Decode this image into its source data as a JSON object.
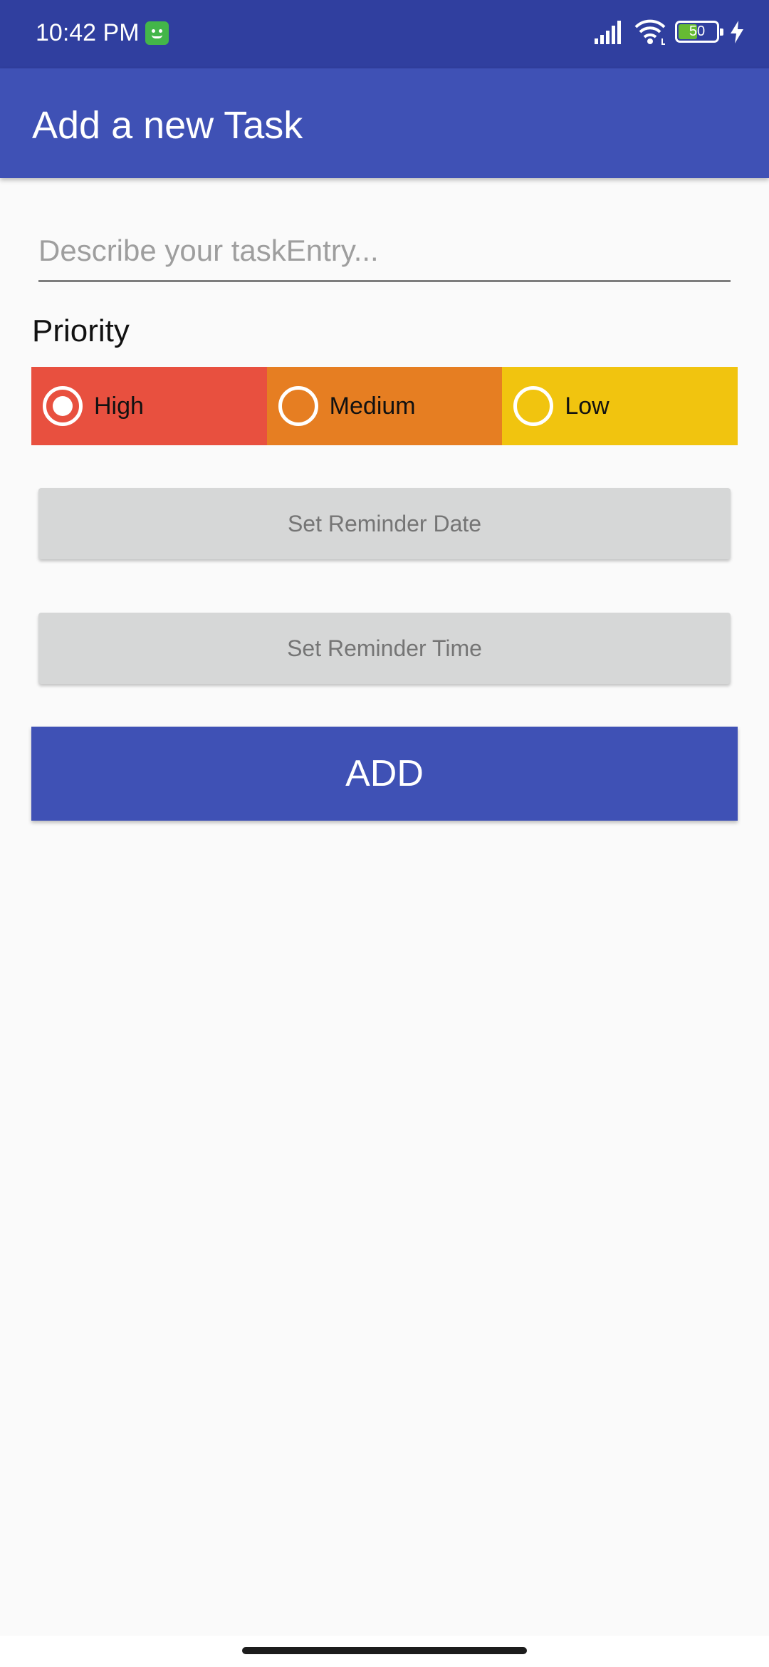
{
  "status_bar": {
    "time": "10:42 PM",
    "battery_level": "50",
    "icons": [
      "notification-app-icon",
      "signal-icon",
      "wifi-icon",
      "battery-icon",
      "charging-icon"
    ]
  },
  "app_bar": {
    "title": "Add a new Task"
  },
  "task_input": {
    "value": "",
    "placeholder": "Describe your taskEntry..."
  },
  "priority": {
    "label": "Priority",
    "options": [
      {
        "label": "High",
        "color": "#e8503f",
        "selected": true
      },
      {
        "label": "Medium",
        "color": "#e67e22",
        "selected": false
      },
      {
        "label": "Low",
        "color": "#f1c40f",
        "selected": false
      }
    ]
  },
  "buttons": {
    "set_date": "Set Reminder Date",
    "set_time": "Set Reminder Time",
    "add": "ADD"
  },
  "colors": {
    "primary": "#3f51b5",
    "primary_dark": "#303f9f",
    "background": "#fafafa"
  }
}
